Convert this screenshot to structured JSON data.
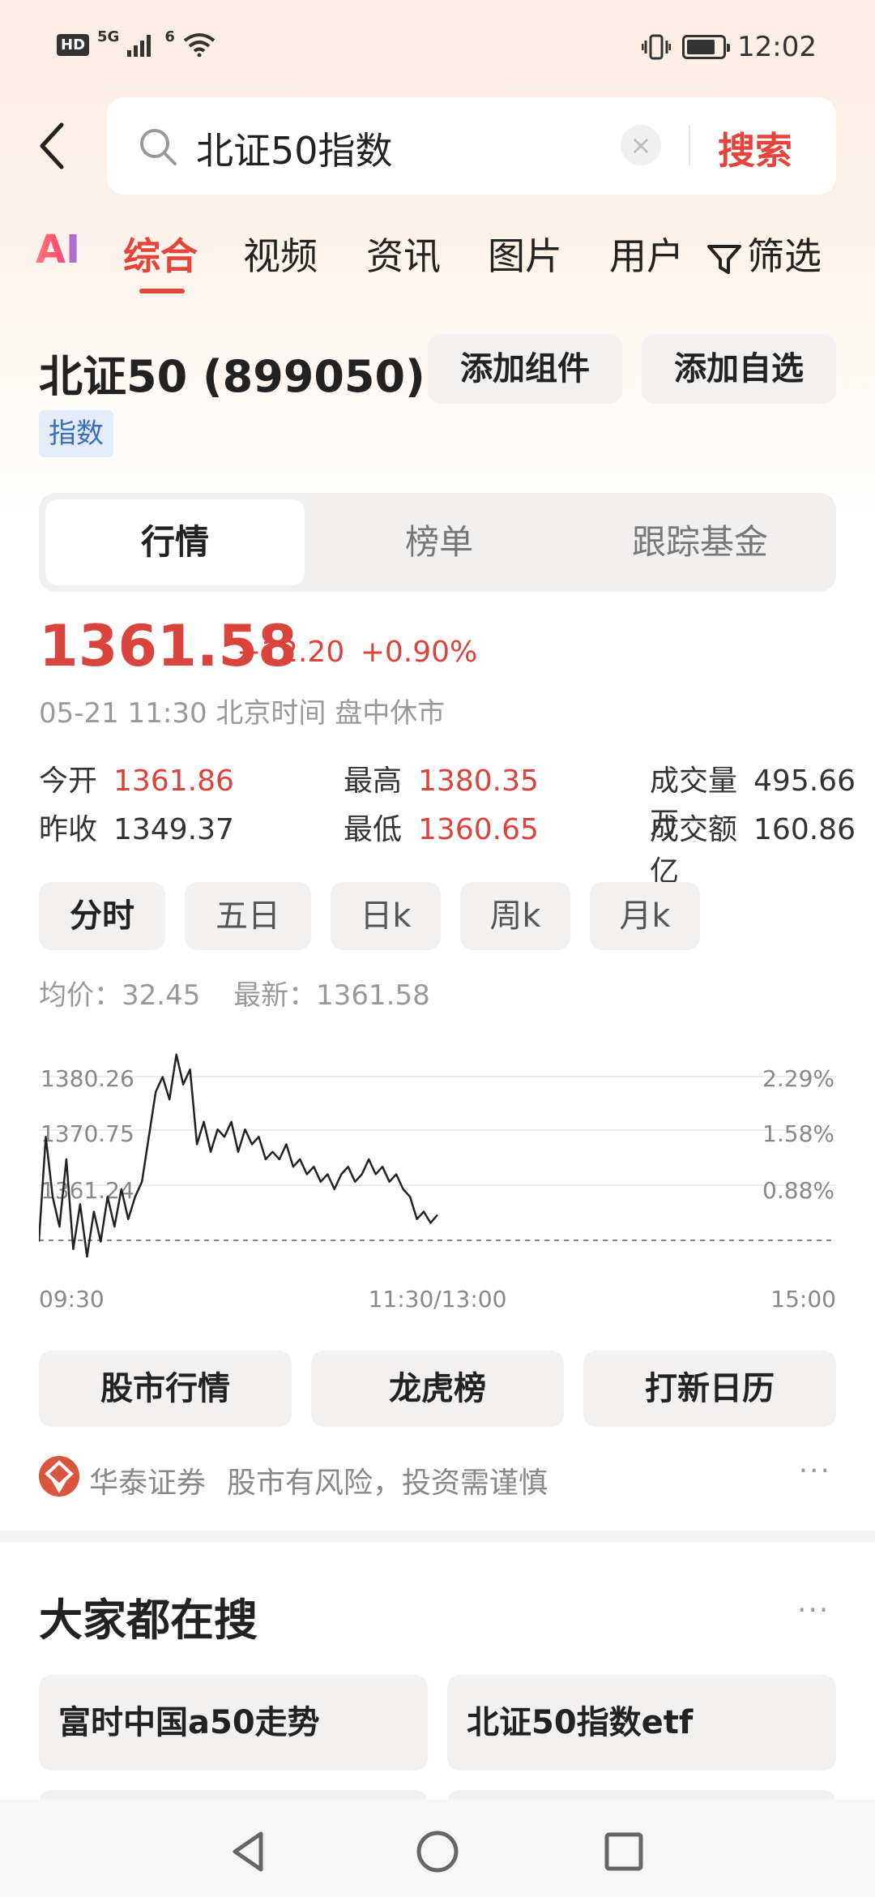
{
  "status_bar": {
    "hd": "HD",
    "signal_5g": "5G",
    "wifi_6": "6",
    "time": "12:02",
    "battery_level": 0.8
  },
  "search": {
    "query": "北证50指数",
    "button": "搜索"
  },
  "tabs": [
    {
      "label": "AI"
    },
    {
      "label": "综合"
    },
    {
      "label": "视频"
    },
    {
      "label": "资讯"
    },
    {
      "label": "图片"
    },
    {
      "label": "用户"
    },
    {
      "label": "筛选"
    }
  ],
  "stock": {
    "title": "北证50 (899050)",
    "add_widget": "添加组件",
    "add_watchlist": "添加自选",
    "tag": "指数"
  },
  "segments": [
    "行情",
    "榜单",
    "跟踪基金"
  ],
  "quote": {
    "price": "1361.58",
    "change": "+12.20",
    "change_pct": "+0.90%",
    "time_info": "05-21 11:30 北京时间 盘中休市",
    "open_label": "今开",
    "open": "1361.86",
    "high_label": "最高",
    "high": "1380.35",
    "volume_label": "成交量",
    "volume": "495.66万",
    "prev_label": "昨收",
    "prev": "1349.37",
    "low_label": "最低",
    "low": "1360.65",
    "amount_label": "成交额",
    "amount": "160.86亿"
  },
  "periods": [
    "分时",
    "五日",
    "日k",
    "周k",
    "月k"
  ],
  "avg_line": {
    "avg_label": "均价：",
    "avg": "32.45",
    "latest_label": "最新：",
    "latest": "1361.58"
  },
  "chart_data": {
    "type": "line",
    "y_left_ticks": [
      "1380.26",
      "1370.75",
      "1361.24"
    ],
    "y_right_ticks": [
      "2.29%",
      "1.58%",
      "0.88%"
    ],
    "x_ticks": [
      "09:30",
      "11:30/13:00",
      "15:00"
    ],
    "ylim": [
      1356,
      1382
    ],
    "series": [
      {
        "values": [
          1358,
          1372,
          1364,
          1360,
          1369,
          1357,
          1363,
          1356,
          1362,
          1358,
          1364,
          1360,
          1365,
          1361,
          1364,
          1366,
          1372,
          1378,
          1380,
          1377,
          1383,
          1379,
          1381,
          1371,
          1374,
          1370,
          1373,
          1372,
          1374,
          1370,
          1373,
          1371,
          1372,
          1369,
          1370,
          1369,
          1371,
          1368,
          1369,
          1367,
          1368,
          1366,
          1367,
          1365,
          1367,
          1368,
          1366,
          1367,
          1369,
          1367,
          1368,
          1366,
          1367,
          1365,
          1364,
          1361,
          1362,
          1360.5,
          1361.58
        ]
      }
    ]
  },
  "shortcuts": [
    "股市行情",
    "龙虎榜",
    "打新日历"
  ],
  "broker": {
    "name": "华泰证券",
    "disclaimer": "股市有风险，投资需谨慎",
    "more": "···"
  },
  "hot": {
    "title": "大家都在搜",
    "more": "···",
    "items": [
      "富时中国a50走势",
      "北证50指数etf"
    ]
  },
  "colors": {
    "accent_red": "#e5443b",
    "price_red": "#d9443c",
    "tag_blue": "#3a6fbf"
  }
}
